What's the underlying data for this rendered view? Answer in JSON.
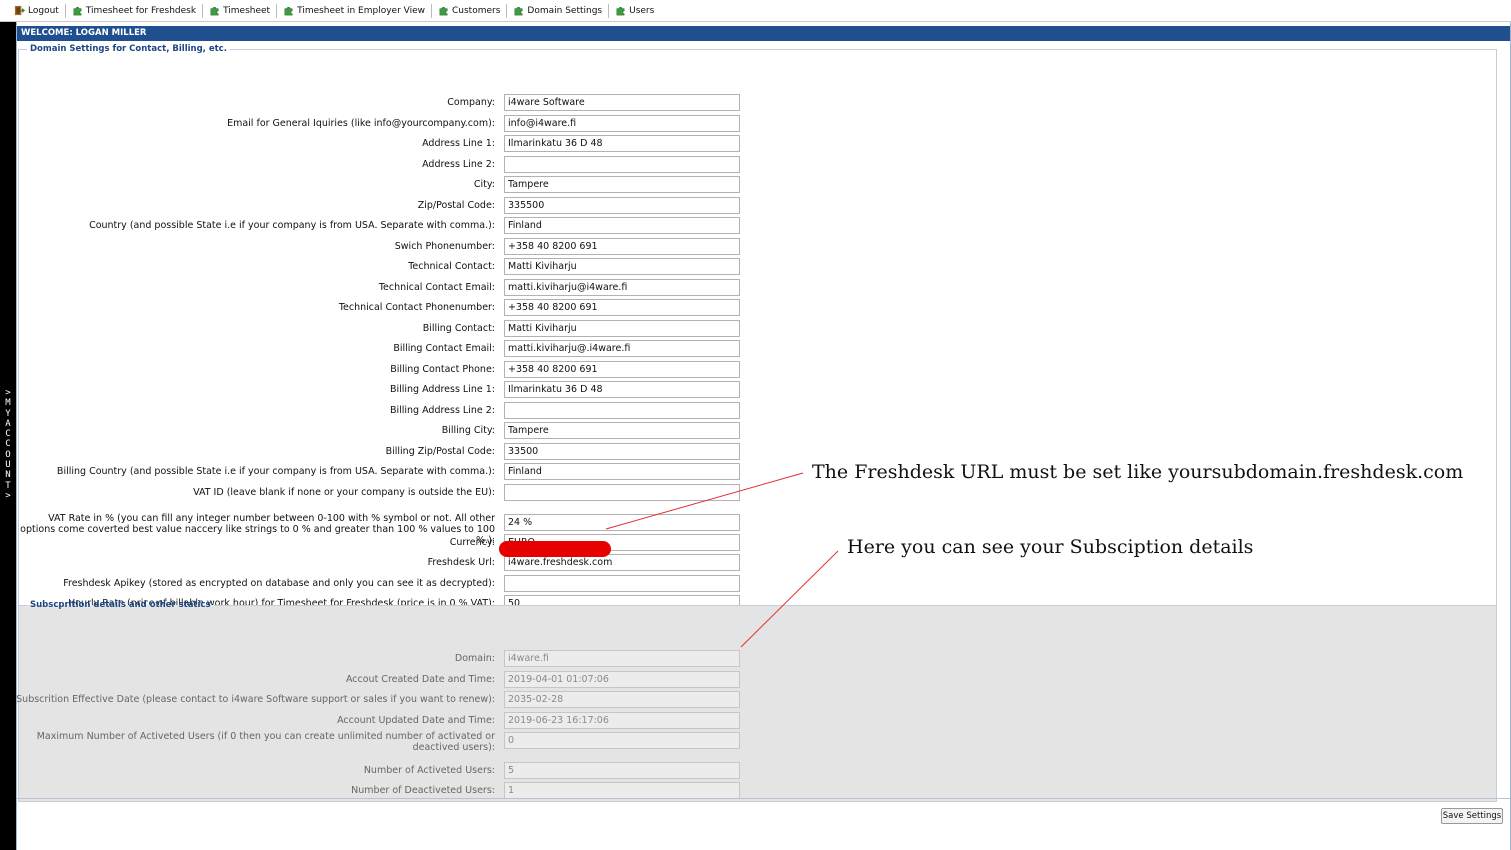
{
  "nav": {
    "items": [
      {
        "label": "Logout",
        "icon": "logout-icon"
      },
      {
        "label": "Timesheet for Freshdesk",
        "icon": "puzzle-icon"
      },
      {
        "label": "Timesheet",
        "icon": "puzzle-icon"
      },
      {
        "label": "Timesheet in Employer View",
        "icon": "puzzle-icon"
      },
      {
        "label": "Customers",
        "icon": "puzzle-icon"
      },
      {
        "label": "Domain Settings",
        "icon": "puzzle-icon"
      },
      {
        "label": "Users",
        "icon": "puzzle-icon"
      }
    ]
  },
  "sidebar": {
    "label": "> MY ACCOUNT >"
  },
  "welcome": "WELCOME: LOGAN MILLER",
  "contact": {
    "legend": "Domain Settings for Contact, Billing, etc.",
    "fields": [
      {
        "label": "Company:",
        "value": "i4ware Software"
      },
      {
        "label": "Email for General Iquiries (like info@yourcompany.com):",
        "value": "info@i4ware.fi"
      },
      {
        "label": "Address Line 1:",
        "value": "Ilmarinkatu 36 D 48"
      },
      {
        "label": "Address Line 2:",
        "value": ""
      },
      {
        "label": "City:",
        "value": "Tampere"
      },
      {
        "label": "Zip/Postal Code:",
        "value": "335500"
      },
      {
        "label": "Country (and possible State i.e if your company is from USA. Separate with comma.):",
        "value": "Finland"
      },
      {
        "label": "Swich Phonenumber:",
        "value": "+358 40 8200 691"
      },
      {
        "label": "Technical Contact:",
        "value": "Matti Kiviharju"
      },
      {
        "label": "Technical Contact Email:",
        "value": "matti.kiviharju@i4ware.fi"
      },
      {
        "label": "Technical Contact Phonenumber:",
        "value": "+358 40 8200 691"
      },
      {
        "label": "Billing Contact:",
        "value": "Matti Kiviharju"
      },
      {
        "label": "Billing Contact Email:",
        "value": "matti.kiviharju@.i4ware.fi"
      },
      {
        "label": "Billing Contact Phone:",
        "value": "+358 40 8200 691"
      },
      {
        "label": "Billing Address Line 1:",
        "value": "Ilmarinkatu 36 D 48"
      },
      {
        "label": "Billing Address Line 2:",
        "value": ""
      },
      {
        "label": "Billing City:",
        "value": "Tampere"
      },
      {
        "label": "Billing Zip/Postal Code:",
        "value": "33500"
      },
      {
        "label": "Billing Country (and possible State i.e if your company is from USA. Separate with comma.):",
        "value": "Finland"
      },
      {
        "label": "VAT ID (leave blank if none or your company is outside the EU):",
        "value": ""
      },
      {
        "label": "VAT Rate in % (you can fill any integer number between 0-100 with % symbol or not. All other options come coverted best value naccery like strings to 0 % and greater than 100 % values to 100 %.):",
        "value": "24 %"
      },
      {
        "label": "Currency:",
        "value": "EURO"
      },
      {
        "label": "Freshdesk Url:",
        "value": "i4ware.freshdesk.com"
      },
      {
        "label": "Freshdesk Apikey (stored as encrypted on database and only you can see it as decrypted):",
        "value": ""
      },
      {
        "label": "Hourly Rate (price of billable work hour) for Timesheet for Freshdesk (price is in 0 % VAT):",
        "value": "50"
      }
    ]
  },
  "subscription": {
    "legend": "Subscprition details and other statics",
    "fields": [
      {
        "label": "Domain:",
        "value": "i4ware.fi"
      },
      {
        "label": "Accout Created Date and Time:",
        "value": "2019-04-01 01:07:06"
      },
      {
        "label": "Subscrition Effective Date (please contact to i4ware Software support or sales if you want to renew):",
        "value": "2035-02-28"
      },
      {
        "label": "Account Updated Date and Time:",
        "value": "2019-06-23 16:17:06"
      },
      {
        "label": "Maximum Number of Activeted Users (if 0 then you can create unlimited number of activated or deactived users):",
        "value": "0"
      },
      {
        "label": "Number of Activeted Users:",
        "value": "5"
      },
      {
        "label": "Number of Deactiveted Users:",
        "value": "1"
      }
    ]
  },
  "annotations": {
    "url_note": "The Freshdesk URL must be set like yoursubdomain.freshdesk.com",
    "subscription_note": "Here you can see your Subsciption details"
  },
  "save_button": "Save Settings",
  "colors": {
    "header_blue": "#1f4f8e",
    "legend_blue": "#1e4682",
    "annotation_line": "#e03030",
    "redaction": "#e60000"
  }
}
